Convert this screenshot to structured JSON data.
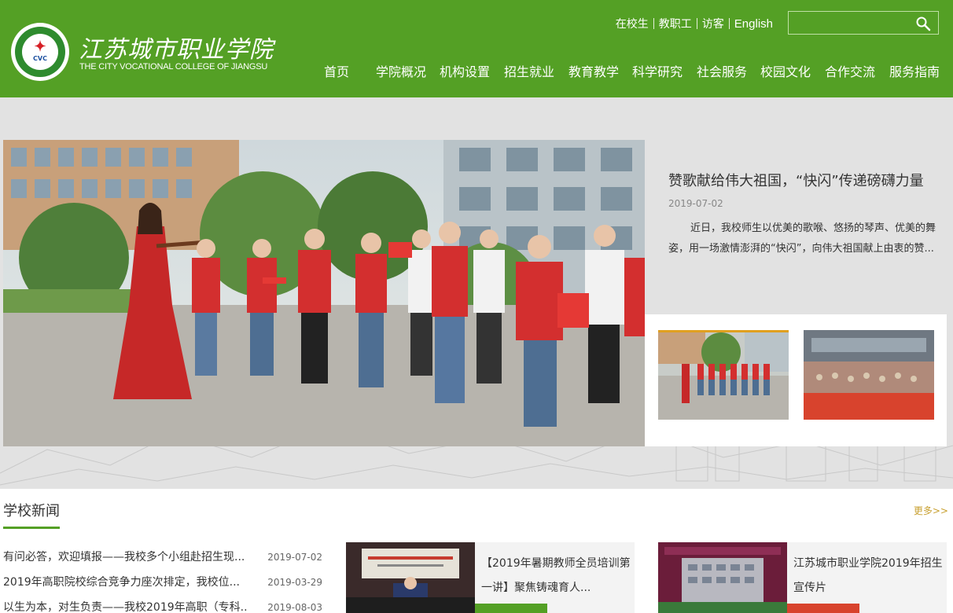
{
  "header": {
    "logo_seal_text": "江苏城市职业学院",
    "logo_cvc": "CVC",
    "logo_cn": "江苏城市职业学院",
    "logo_en": "THE CITY VOCATIONAL COLLEGE OF JIANGSU",
    "toplinks": [
      "在校生",
      "教职工",
      "访客",
      "English"
    ],
    "search_placeholder": "",
    "nav": [
      "首页",
      "学院概况",
      "机构设置",
      "招生就业",
      "教育教学",
      "科学研究",
      "社会服务",
      "校园文化",
      "合作交流",
      "服务指南"
    ],
    "brand_color": "#54a025"
  },
  "banner": {
    "title": "赞歌献给伟大祖国，“快闪”传递磅礴力量",
    "date": "2019-07-02",
    "summary": "近日，我校师生以优美的歌喉、悠扬的琴声、优美的舞姿，用一场激情澎湃的“快闪”，向伟大祖国献上由衷的赞..."
  },
  "news_section": {
    "title": "学校新闻",
    "more": "更多>>",
    "items": [
      {
        "title": "有问必答，欢迎填报——我校多个小组赴招生现...",
        "date": "2019-07-02"
      },
      {
        "title": "2019年高职院校综合竞争力座次排定，我校位...",
        "date": "2019-03-29"
      },
      {
        "title": "以生为本，对生负责——我校2019年高职（专科...",
        "date": "2019-08-03"
      }
    ],
    "cards": [
      {
        "text": "【2019年暑期教师全员培训第一讲】聚焦铸魂育人...",
        "accent": "#54a025"
      },
      {
        "text": "江苏城市职业学院2019年招生宣传片",
        "accent": "#d8432d"
      }
    ]
  }
}
